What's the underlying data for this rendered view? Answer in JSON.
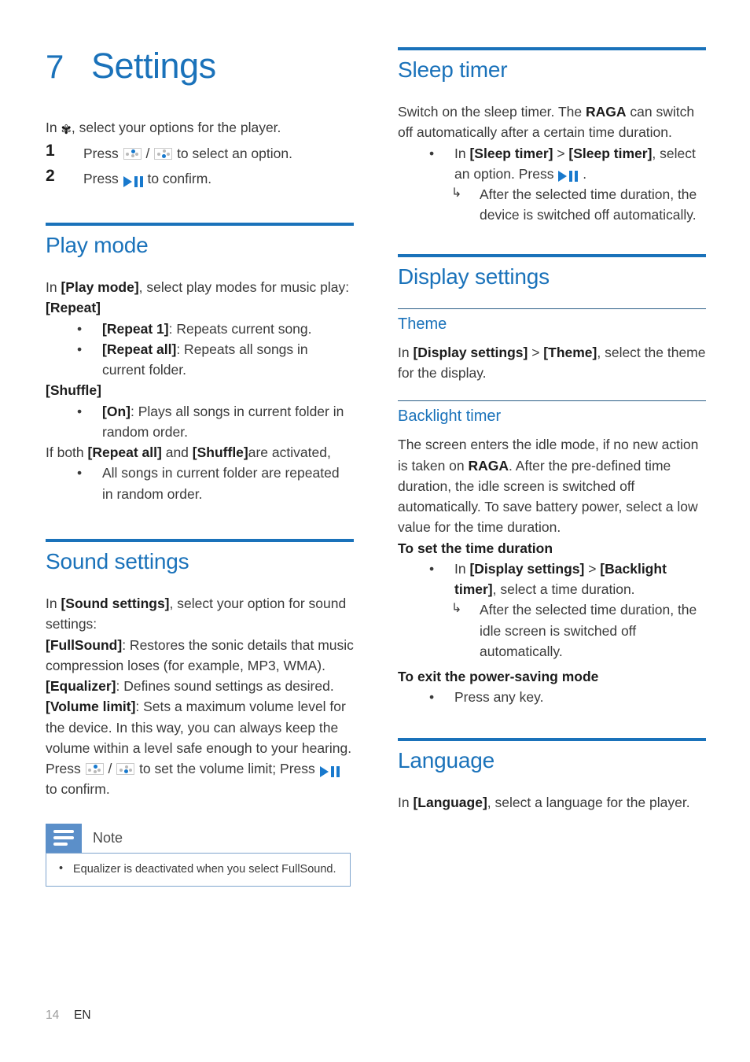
{
  "chapter": {
    "number": "7",
    "title": "Settings"
  },
  "intro": {
    "before_icon": "In ",
    "gear_icon": "gear-icon",
    "after_icon": ", select your options for the player.",
    "steps": [
      {
        "number": "1",
        "before": "Press ",
        "icon_a": "nav-up-icon",
        "between": " / ",
        "icon_b": "nav-down-icon",
        "after": " to select an option."
      },
      {
        "number": "2",
        "before": "Press ",
        "icon_a": "play-pause-icon",
        "after": " to confirm."
      }
    ]
  },
  "play_mode": {
    "heading": "Play mode",
    "intro_prefix": "In ",
    "intro_bold": "[Play mode]",
    "intro_suffix": ", select play modes for music play:",
    "repeat_label": "[Repeat]",
    "repeat_items": [
      {
        "bold": "[Repeat 1]",
        "rest": ": Repeats current song."
      },
      {
        "bold": "[Repeat all]",
        "rest": ": Repeats all songs in current folder."
      }
    ],
    "shuffle_label": "[Shuffle]",
    "shuffle_items": [
      {
        "bold": "[On]",
        "rest": ": Plays all songs in current folder in random order."
      }
    ],
    "both_prefix": "If both ",
    "both_bold_a": "[Repeat all]",
    "both_mid": " and ",
    "both_bold_b": "[Shuffle]",
    "both_suffix": "are activated,",
    "both_items": [
      "All songs in current folder are repeated in random order."
    ]
  },
  "sound_settings": {
    "heading": "Sound settings",
    "intro_prefix": "In ",
    "intro_bold": "[Sound settings]",
    "intro_suffix": ", select your option for sound settings:",
    "fullsound_bold": "[FullSound]",
    "fullsound_rest": ": Restores the sonic details that music compression loses (for example, MP3, WMA).",
    "equalizer_bold": "[Equalizer]",
    "equalizer_rest": ": Defines sound settings as desired.",
    "volume_bold": "[Volume limit]",
    "volume_rest": ": Sets a maximum volume level for the device. In this way, you can always keep the volume within a level safe enough to your hearing.",
    "press_before": "Press ",
    "press_icon_a": "nav-up-icon",
    "press_between": " / ",
    "press_icon_b": "nav-down-icon",
    "press_mid": " to set the volume limit; Press ",
    "press_icon_c": "play-pause-icon",
    "press_after": " to confirm."
  },
  "note": {
    "icon": "note-icon",
    "title": "Note",
    "items": [
      "Equalizer is deactivated when you select FullSound."
    ]
  },
  "sleep_timer": {
    "heading": "Sleep timer",
    "intro_prefix": "Switch on the sleep timer. The ",
    "intro_bold": "RAGA",
    "intro_suffix": " can switch off automatically after a certain time duration.",
    "bullet": {
      "prefix": "In ",
      "bold_a": "[Sleep timer]",
      "mid": " > ",
      "bold_b": "[Sleep timer]",
      "suffix": ", select an option. Press ",
      "icon": "play-pause-icon",
      "tail": " ."
    },
    "sub_bullet": "After the selected time duration, the device is switched off automatically."
  },
  "display_settings": {
    "heading": "Display settings",
    "theme": {
      "heading": "Theme",
      "prefix": "In ",
      "bold_a": "[Display settings]",
      "mid": " > ",
      "bold_b": "[Theme]",
      "suffix": ", select the theme for the display."
    },
    "backlight": {
      "heading": "Backlight timer",
      "para_prefix": "The screen enters the idle mode, if no new action is taken on ",
      "para_bold": "RAGA",
      "para_suffix": ". After the pre-defined time duration, the idle screen is switched off automatically. To save battery power, select a low value for the time duration.",
      "set_heading": "To set the time duration",
      "set_bullet": {
        "prefix": "In ",
        "bold_a": "[Display settings]",
        "mid": " > ",
        "bold_b": "[Backlight timer]",
        "suffix": ", select a time duration."
      },
      "set_sub_bullet": "After the selected time duration, the idle screen is switched off automatically.",
      "exit_heading": "To exit the power-saving mode",
      "exit_bullet": "Press any key."
    }
  },
  "language": {
    "heading": "Language",
    "prefix": "In ",
    "bold": "[Language]",
    "suffix": ", select a language for the player."
  },
  "markers": {
    "bullet": "•",
    "arrow": "↳",
    "gear": "✾"
  },
  "footer": {
    "page_number": "14",
    "language_code": "EN"
  },
  "colors": {
    "heading_blue": "#1a72ba",
    "icon_blue": "#1879cd",
    "note_blue": "#5b8fc9",
    "body": "#3a3a3a"
  }
}
